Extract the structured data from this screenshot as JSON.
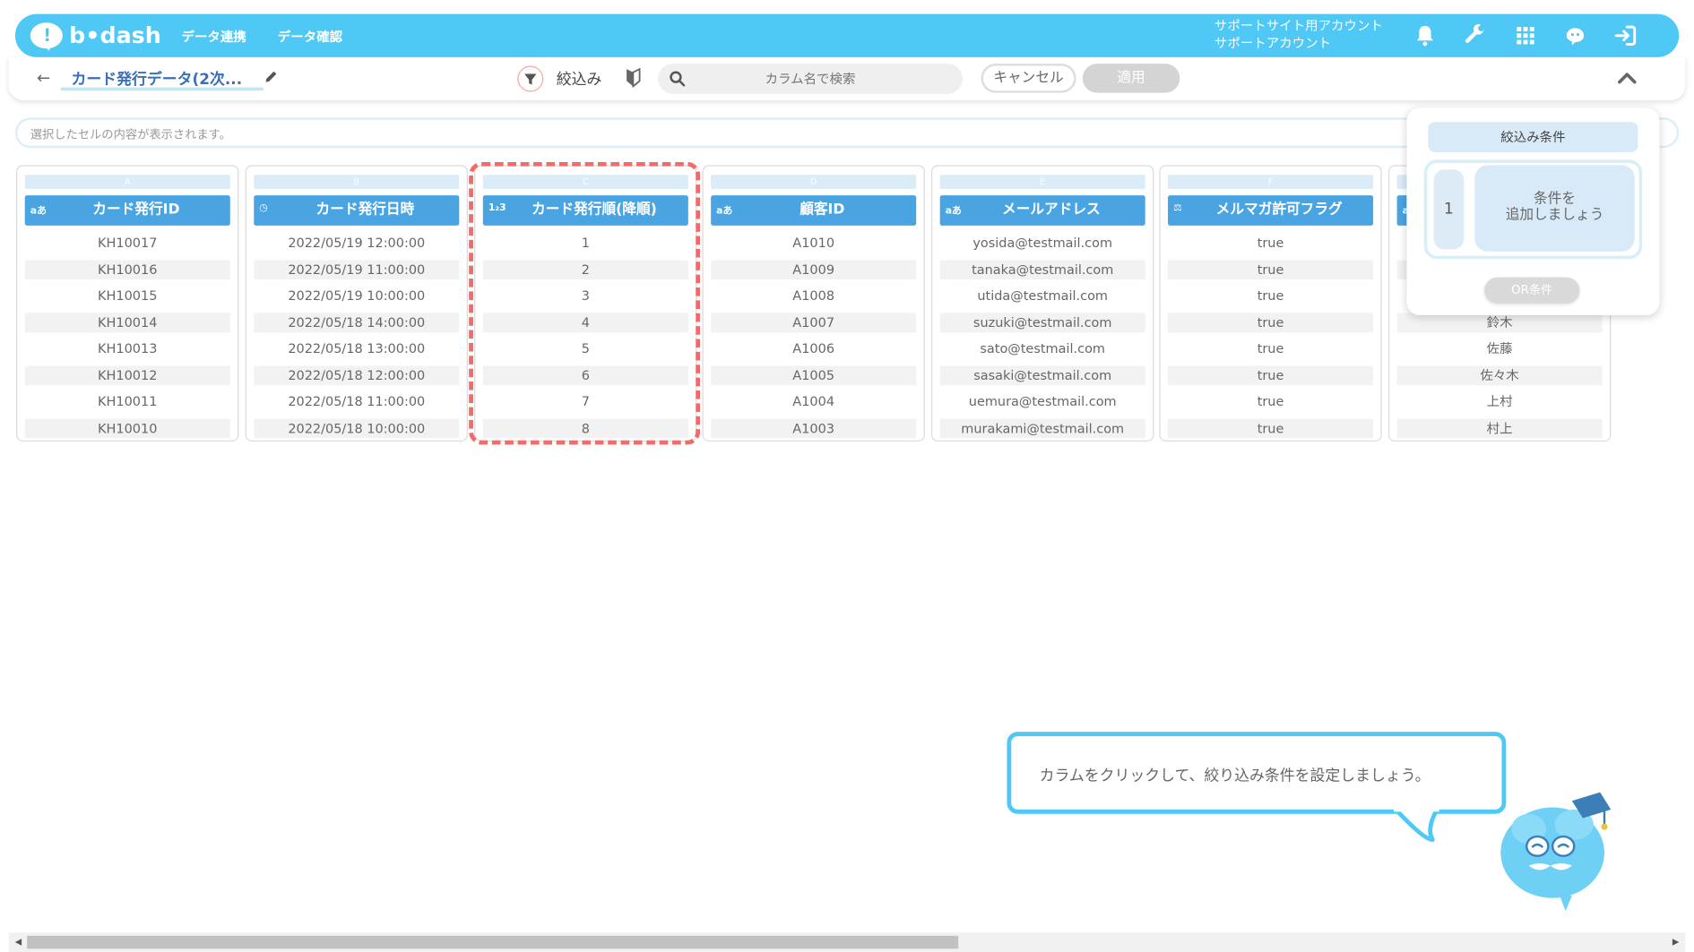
{
  "header": {
    "brand": "b•dash",
    "nav": [
      "データ連携",
      "データ確認"
    ],
    "account_line1": "サポートサイト用アカウント",
    "account_line2": "サポートアカウント"
  },
  "toolbar": {
    "back_arrow": "←",
    "dataset_title": "カード発行データ(2次...",
    "filter_label": "絞込み",
    "search_placeholder": "カラム名で検索",
    "cancel_label": "キャンセル",
    "apply_label": "適用"
  },
  "cell_bar": {
    "placeholder": "選択したセルの内容が表示されます。"
  },
  "table": {
    "columns": [
      {
        "letter": "A",
        "type_icon": "text-icon",
        "type_glyph": "aあ",
        "header": "カード発行ID",
        "cells": [
          "KH10017",
          "KH10016",
          "KH10015",
          "KH10014",
          "KH10013",
          "KH10012",
          "KH10011",
          "KH10010"
        ]
      },
      {
        "letter": "B",
        "type_icon": "clock-icon",
        "type_glyph": "◷",
        "header": "カード発行日時",
        "cells": [
          "2022/05/19 12:00:00",
          "2022/05/19 11:00:00",
          "2022/05/19 10:00:00",
          "2022/05/18 14:00:00",
          "2022/05/18 13:00:00",
          "2022/05/18 12:00:00",
          "2022/05/18 11:00:00",
          "2022/05/18 10:00:00"
        ]
      },
      {
        "letter": "C",
        "type_icon": "number-icon",
        "type_glyph": "1₂3",
        "header": "カード発行順(降順)",
        "cells": [
          "1",
          "2",
          "3",
          "4",
          "5",
          "6",
          "7",
          "8"
        ]
      },
      {
        "letter": "D",
        "type_icon": "text-icon",
        "type_glyph": "aあ",
        "header": "顧客ID",
        "cells": [
          "A1010",
          "A1009",
          "A1008",
          "A1007",
          "A1006",
          "A1005",
          "A1004",
          "A1003"
        ]
      },
      {
        "letter": "E",
        "type_icon": "text-icon",
        "type_glyph": "aあ",
        "header": "メールアドレス",
        "cells": [
          "yosida@testmail.com",
          "tanaka@testmail.com",
          "utida@testmail.com",
          "suzuki@testmail.com",
          "sato@testmail.com",
          "sasaki@testmail.com",
          "uemura@testmail.com",
          "murakami@testmail.com"
        ]
      },
      {
        "letter": "F",
        "type_icon": "boolean-icon",
        "type_glyph": "⚖",
        "header": "メルマガ許可フラグ",
        "cells": [
          "true",
          "true",
          "true",
          "true",
          "true",
          "true",
          "true",
          "true"
        ]
      },
      {
        "letter": "G",
        "type_icon": "text-icon",
        "type_glyph": "aあ",
        "header": "",
        "cells": [
          "",
          "",
          "",
          "鈴木",
          "佐藤",
          "佐々木",
          "上村",
          "村上"
        ]
      }
    ]
  },
  "filter_panel": {
    "title": "絞込み条件",
    "group_number": "1",
    "add_condition_line1": "条件を",
    "add_condition_line2": "追加しましょう",
    "or_button": "OR条件"
  },
  "tooltip": {
    "message": "カラムをクリックして、絞り込み条件を設定しましょう。"
  },
  "colors": {
    "brand": "#4fc8f6",
    "header_blue": "#4aa4e2",
    "highlight": "#f26b6b"
  }
}
